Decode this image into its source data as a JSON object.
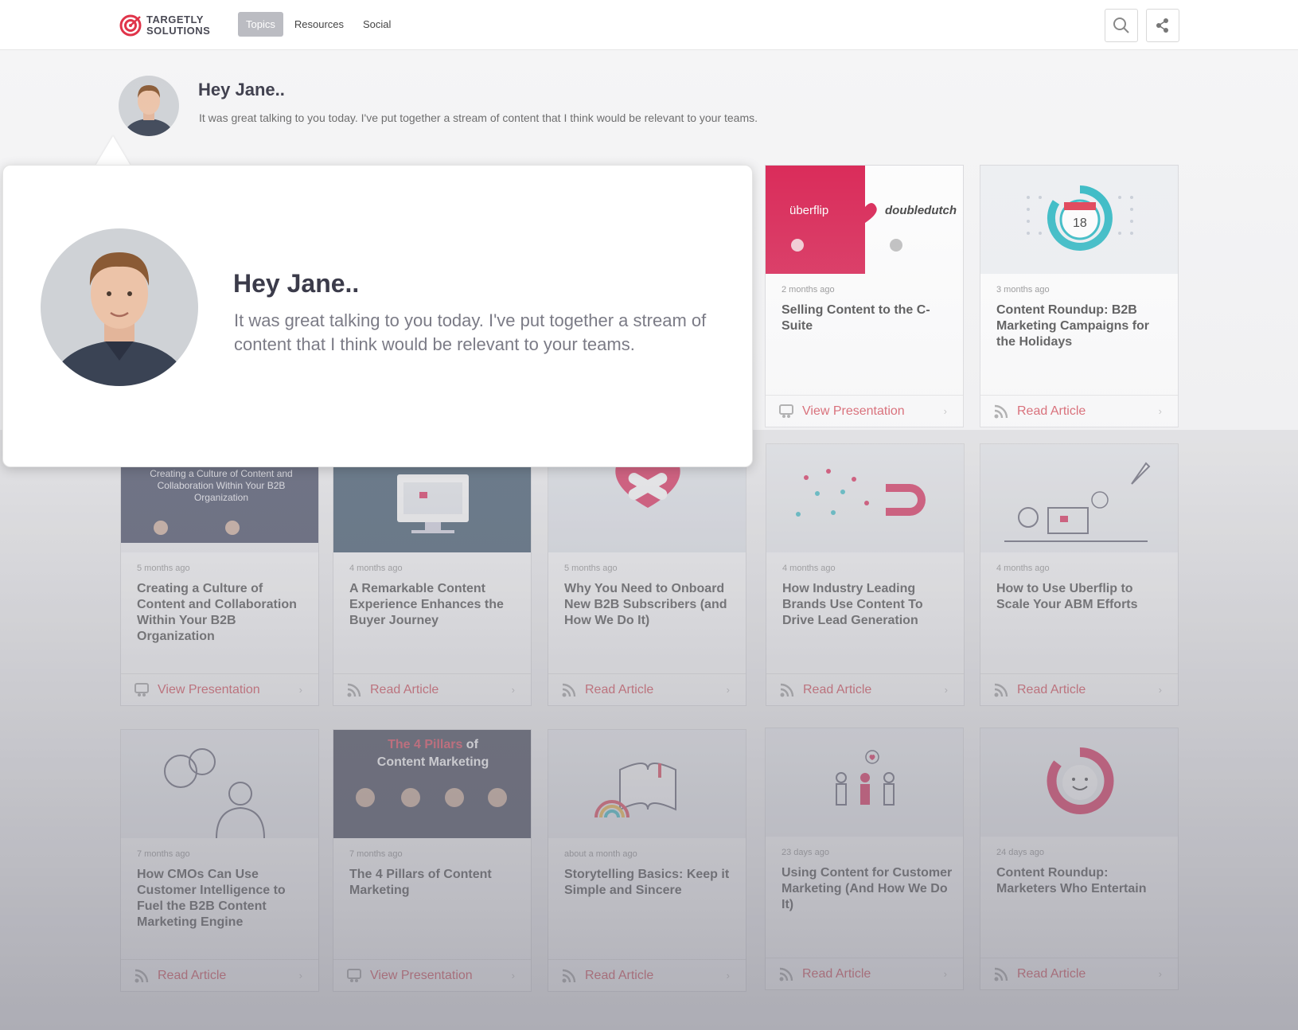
{
  "brand": {
    "line1": "TARGETLY",
    "line2": "SOLUTIONS",
    "accent": "#e0344a"
  },
  "nav": {
    "items": [
      {
        "label": "Topics",
        "active": true
      },
      {
        "label": "Resources",
        "active": false
      },
      {
        "label": "Social",
        "active": false
      }
    ]
  },
  "greeting": {
    "title": "Hey Jane..",
    "text": "It was great talking to you today. I've put  together a stream of content that I think would be relevant to your teams."
  },
  "popover": {
    "title": "Hey Jane..",
    "text": "It was great talking to you today. I've put  together a stream of content that I think would be relevant to your teams."
  },
  "cards": [
    {
      "date": "2 months ago",
      "title": "Selling Content to the C-Suite",
      "action": "View Presentation",
      "icon": "presentation-icon",
      "thumb": {
        "left": "überflip",
        "right": "doubledutch"
      }
    },
    {
      "date": "3 months ago",
      "title": "Content Roundup: B2B Marketing Campaigns for the Holidays",
      "action": "Read Article",
      "icon": "rss-icon",
      "thumb": {
        "day": "18"
      }
    },
    {
      "date": "5 months ago",
      "title": "Creating a Culture of Content and Collaboration Within Your B2B Organization",
      "action": "View Presentation",
      "icon": "presentation-icon",
      "thumb": {
        "headline": "Creating a Culture of Content and Collaboration Within Your B2B Organization"
      }
    },
    {
      "date": "4 months ago",
      "title": "A Remarkable Content Experience Enhances the Buyer Journey",
      "action": "Read Article",
      "icon": "rss-icon"
    },
    {
      "date": "5 months ago",
      "title": "Why You Need to Onboard New B2B Subscribers (and How We Do It)",
      "action": "Read Article",
      "icon": "rss-icon"
    },
    {
      "date": "4 months ago",
      "title": "How Industry Leading Brands Use Content To Drive Lead Generation",
      "action": "Read Article",
      "icon": "rss-icon"
    },
    {
      "date": "4 months ago",
      "title": "How to Use Uberflip to Scale Your ABM Efforts",
      "action": "Read Article",
      "icon": "rss-icon"
    },
    {
      "date": "7 months ago",
      "title": "How CMOs Can Use Customer Intelligence to Fuel the B2B Content Marketing Engine",
      "action": "Read Article",
      "icon": "rss-icon"
    },
    {
      "date": "7 months ago",
      "title": "The 4 Pillars of Content Marketing",
      "action": "View Presentation",
      "icon": "presentation-icon",
      "thumb": {
        "headline_a": "The 4 Pillars",
        "headline_b": " of",
        "headline_c": "Content Marketing"
      }
    },
    {
      "date": "about a month ago",
      "title": "Storytelling Basics: Keep it Simple and Sincere",
      "action": "Read Article",
      "icon": "rss-icon"
    },
    {
      "date": "23 days ago",
      "title": "Using Content for Customer Marketing (And How We Do It)",
      "action": "Read Article",
      "icon": "rss-icon"
    },
    {
      "date": "24 days ago",
      "title": "Content Roundup: Marketers Who Entertain",
      "action": "Read Article",
      "icon": "rss-icon"
    }
  ],
  "icons": {
    "search": "search-icon",
    "share": "share-icon",
    "chevron": "›"
  },
  "colors": {
    "accent_red": "#d33a48",
    "dark_navy": "#2e3347",
    "teal": "#2ab7c2"
  }
}
